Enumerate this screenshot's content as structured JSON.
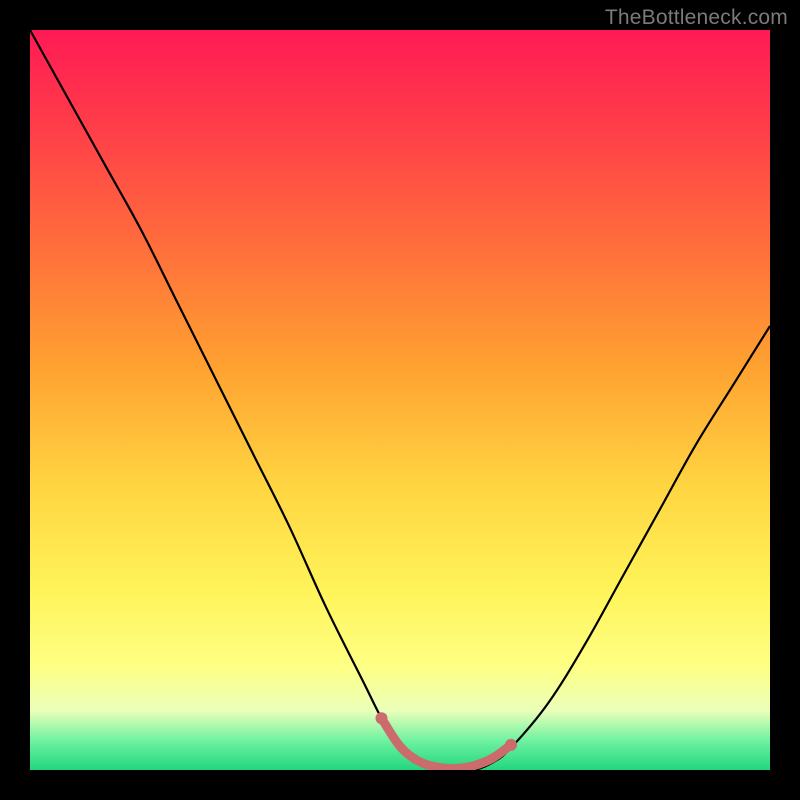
{
  "watermark": "TheBottleneck.com",
  "colors": {
    "frame": "#000000",
    "gradient_top": "#ff1a55",
    "gradient_mid1": "#ff6a3d",
    "gradient_mid2": "#ffd642",
    "gradient_mid3": "#feff84",
    "gradient_bottom": "#22d67e",
    "curve": "#000000",
    "highlight_curve": "#cc6b6b"
  },
  "chart_data": {
    "type": "line",
    "title": "",
    "xlabel": "",
    "ylabel": "",
    "xlim": [
      0,
      1
    ],
    "ylim": [
      0,
      1
    ],
    "annotations": [],
    "series": [
      {
        "name": "bottleneck-curve",
        "x": [
          0.0,
          0.05,
          0.1,
          0.15,
          0.2,
          0.25,
          0.3,
          0.35,
          0.4,
          0.45,
          0.475,
          0.5,
          0.525,
          0.55,
          0.575,
          0.6,
          0.625,
          0.65,
          0.7,
          0.75,
          0.8,
          0.85,
          0.9,
          0.95,
          1.0
        ],
        "y": [
          1.0,
          0.91,
          0.82,
          0.73,
          0.63,
          0.53,
          0.43,
          0.33,
          0.22,
          0.12,
          0.07,
          0.03,
          0.01,
          0.0,
          0.0,
          0.0,
          0.01,
          0.03,
          0.09,
          0.17,
          0.26,
          0.35,
          0.44,
          0.52,
          0.6
        ]
      },
      {
        "name": "optimal-highlight-segment",
        "x": [
          0.475,
          0.5,
          0.525,
          0.55,
          0.575,
          0.6,
          0.625,
          0.65
        ],
        "y": [
          0.07,
          0.032,
          0.012,
          0.004,
          0.002,
          0.006,
          0.016,
          0.034
        ]
      }
    ]
  }
}
